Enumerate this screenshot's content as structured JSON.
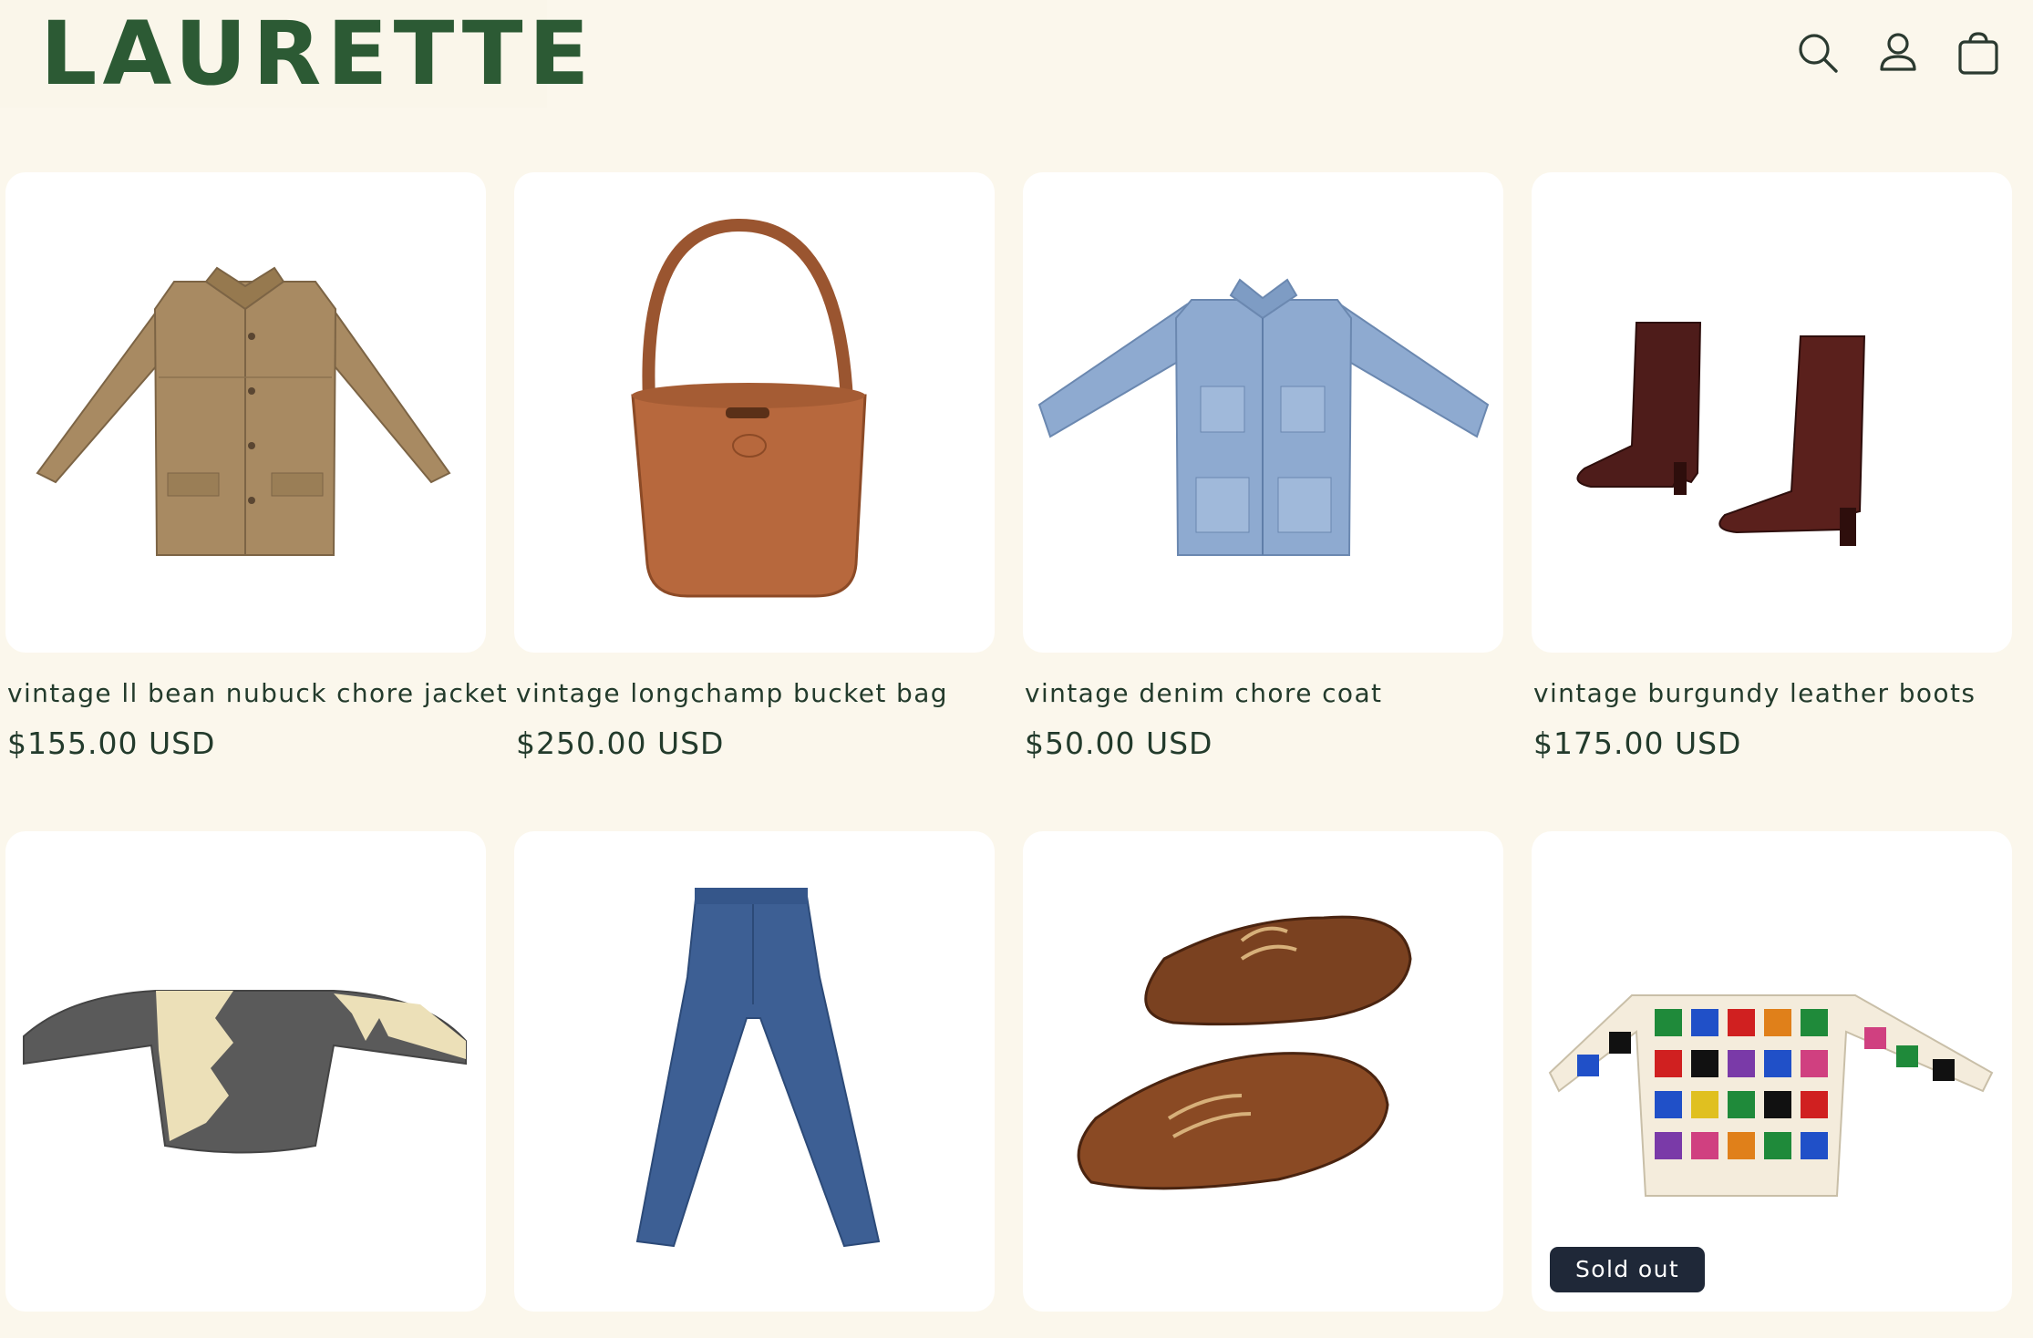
{
  "header": {
    "logo": "LAURETTE",
    "icons": [
      "search-icon",
      "account-icon",
      "cart-icon"
    ]
  },
  "colors": {
    "page_background": "#fbf7ec",
    "brand_green": "#2c5a34",
    "text": "#233b2c",
    "badge_background": "#1f2838"
  },
  "products": [
    {
      "title": "vintage ll bean nubuck chore jacket",
      "price": "$155.00 USD",
      "image": "tan-chore-jacket"
    },
    {
      "title": "vintage longchamp bucket bag",
      "price": "$250.00 USD",
      "image": "brown-leather-bucket-bag"
    },
    {
      "title": "vintage denim chore coat",
      "price": "$50.00 USD",
      "image": "light-denim-chore-coat"
    },
    {
      "title": "vintage burgundy leather boots",
      "price": "$175.00 USD",
      "image": "burgundy-leather-boots"
    },
    {
      "title": "",
      "price": "",
      "image": "grey-cream-zigzag-sweater"
    },
    {
      "title": "",
      "price": "",
      "image": "blue-straight-jeans"
    },
    {
      "title": "",
      "price": "",
      "image": "brown-boat-shoes"
    },
    {
      "title": "",
      "price": "",
      "image": "granny-square-cardigan",
      "badge": "Sold out"
    }
  ]
}
